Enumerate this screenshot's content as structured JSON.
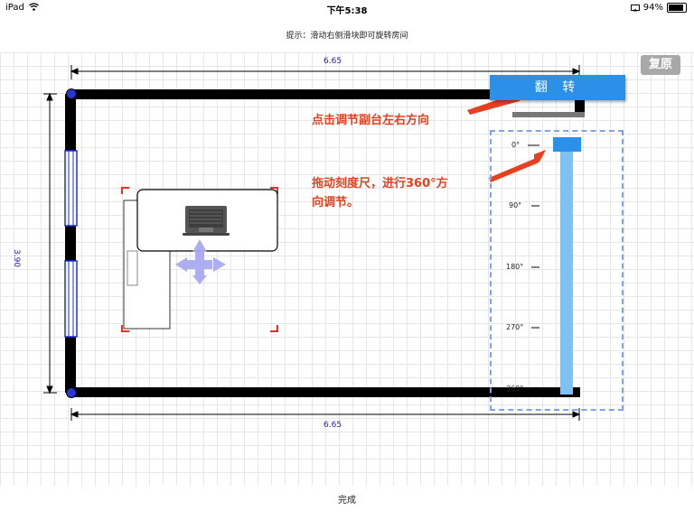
{
  "status": {
    "device": "iPad",
    "time": "下午5:38",
    "battery": "94%"
  },
  "hint": "提示：滑动右侧滑块即可旋转房间",
  "buttons": {
    "reset": "复原",
    "flip": "翻 转",
    "done": "完成"
  },
  "dimensions": {
    "top": "6.65",
    "bottom": "6.65",
    "left": "3.90"
  },
  "annotations": {
    "flip_tip": "点击调节副台左右方向",
    "drag_tip_line1": "拖动刻度尺，进行360°方",
    "drag_tip_line2": "向调节。"
  },
  "ruler": {
    "ticks": [
      "0°",
      "90°",
      "180°",
      "270°",
      "360°"
    ],
    "value": 0
  },
  "colors": {
    "accent": "#2c8fe8",
    "annotation": "#e8401e",
    "wall": "#000000",
    "window": "#1a2fd6"
  },
  "icons": {
    "wifi": "wifi-icon",
    "battery": "battery-icon",
    "laptop": "laptop-icon",
    "move": "move-arrows-icon"
  }
}
